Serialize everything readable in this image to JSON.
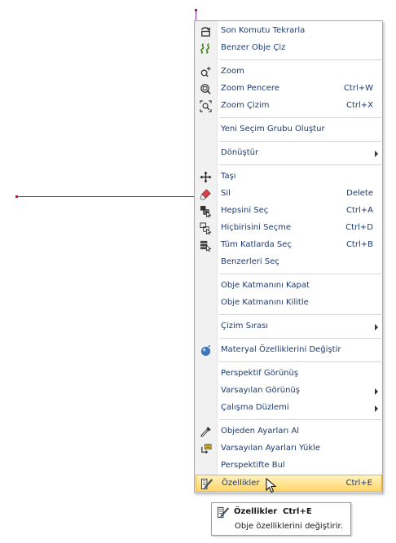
{
  "menu": {
    "items": [
      {
        "label": "Son Komutu Tekrarla",
        "shortcut": "",
        "icon": "repeat-icon"
      },
      {
        "label": "Benzer Obje Çiz",
        "shortcut": "",
        "icon": "similar-draw-icon"
      },
      {
        "label": "Zoom",
        "shortcut": "",
        "icon": "zoom-icon"
      },
      {
        "label": "Zoom Pencere",
        "shortcut": "Ctrl+W",
        "icon": "zoom-window-icon"
      },
      {
        "label": "Zoom Çizim",
        "shortcut": "Ctrl+X",
        "icon": "zoom-extents-icon"
      },
      {
        "label": "Yeni Seçim Grubu Oluştur",
        "shortcut": ""
      },
      {
        "label": "Dönüştür",
        "shortcut": "",
        "submenu": true
      },
      {
        "label": "Taşı",
        "shortcut": "",
        "icon": "move-icon"
      },
      {
        "label": "Sil",
        "shortcut": "Delete",
        "icon": "eraser-icon"
      },
      {
        "label": "Hepsini Seç",
        "shortcut": "Ctrl+A",
        "icon": "select-all-icon"
      },
      {
        "label": "Hiçbirisini Seçme",
        "shortcut": "Ctrl+D",
        "icon": "select-none-icon"
      },
      {
        "label": "Tüm Katlarda Seç",
        "shortcut": "Ctrl+B",
        "icon": "select-all-floors-icon"
      },
      {
        "label": "Benzerleri Seç",
        "shortcut": ""
      },
      {
        "label": "Obje Katmanını Kapat",
        "shortcut": ""
      },
      {
        "label": "Obje Katmanını Kilitle",
        "shortcut": ""
      },
      {
        "label": "Çizim Sırası",
        "shortcut": "",
        "submenu": true
      },
      {
        "label": "Materyal Özelliklerini Değiştir",
        "shortcut": "",
        "icon": "material-icon"
      },
      {
        "label": "Perspektif Görünüş",
        "shortcut": ""
      },
      {
        "label": "Varsayılan Görünüş",
        "shortcut": "",
        "submenu": true
      },
      {
        "label": "Çalışma Düzlemi",
        "shortcut": "",
        "submenu": true
      },
      {
        "label": "Objeden Ayarları Al",
        "shortcut": "",
        "icon": "eyedropper-icon"
      },
      {
        "label": "Varsayılan Ayarları Yükle",
        "shortcut": "",
        "icon": "load-defaults-icon"
      },
      {
        "label": "Perspektifte Bul",
        "shortcut": ""
      },
      {
        "label": "Özellikler",
        "shortcut": "Ctrl+E",
        "icon": "properties-icon",
        "highlighted": true
      }
    ]
  },
  "tooltip": {
    "title": "Özellikler",
    "shortcut": "Ctrl+E",
    "description": "Obje özelliklerini değiştirir."
  },
  "colors": {
    "text": "#1e3a6e",
    "cad_line": "#7a2f9c",
    "highlight": "#ffd66b"
  }
}
